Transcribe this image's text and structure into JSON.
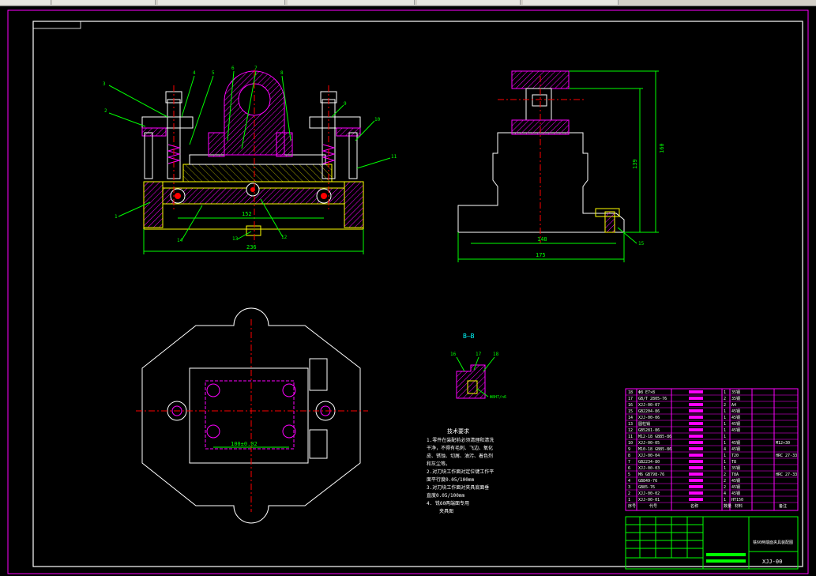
{
  "tech_requirements": {
    "title": "技术要求",
    "lines": [
      "1.零件在装配前必须清理和清洗",
      "干净，不得有毛刺、飞边、氧化",
      "皮、锈蚀、切屑、油污、着色剂",
      "和灰尘等。",
      "2.对刀块工作面对定位键工作平",
      "面平行度0.05/100mm",
      "3.对刀块工作面对夹具底面垂",
      "直度0.05/100mm",
      "4. 铣60两端面专用",
      "夹具图"
    ]
  },
  "section_label": "B—B",
  "dimensions": {
    "front_width": "236",
    "front_inner": "152",
    "side_width": "175",
    "side_inner": "148",
    "side_height1": "160",
    "side_height2": "139",
    "plan_width": "100±0.02",
    "fit_note": "Φ8H7/n6"
  },
  "balloons": [
    "1",
    "2",
    "3",
    "4",
    "5",
    "6",
    "7",
    "8",
    "9",
    "10",
    "11",
    "12",
    "13",
    "14",
    "15",
    "16",
    "17",
    "18"
  ],
  "bom_rows": [
    {
      "no": "18",
      "code": "Φ8 E7×8",
      "qty": "1",
      "mat": "35钢"
    },
    {
      "no": "17",
      "code": "GB/T 2805-76",
      "qty": "2",
      "mat": "35钢"
    },
    {
      "no": "16",
      "code": "XJJ-00-07",
      "qty": "2",
      "mat": "A4"
    },
    {
      "no": "15",
      "code": "GB2204-86",
      "qty": "1",
      "mat": "45钢"
    },
    {
      "no": "14",
      "code": "XJJ-00-06",
      "qty": "1",
      "mat": "45钢"
    },
    {
      "no": "13",
      "code": "圆柱销",
      "qty": "1",
      "mat": "45钢"
    },
    {
      "no": "12",
      "code": "GB5281-86",
      "qty": "1",
      "mat": "45钢"
    },
    {
      "no": "11",
      "code": "M12-18 GB85-86",
      "qty": "1",
      "mat": ""
    },
    {
      "no": "10",
      "code": "XJJ-00-05",
      "qty": "1",
      "mat": "45钢",
      "extra": "M12×30"
    },
    {
      "no": "9",
      "code": "M10-18 GB85-86",
      "qty": "4",
      "mat": "45钢"
    },
    {
      "no": "8",
      "code": "XJJ-00-04",
      "qty": "1",
      "mat": "T20",
      "extra": "HRC 27-33"
    },
    {
      "no": "7",
      "code": "GB2234-80",
      "qty": "1",
      "mat": "T8"
    },
    {
      "no": "6",
      "code": "XJJ-00-03",
      "qty": "1",
      "mat": "35钢"
    },
    {
      "no": "5",
      "code": "M6 GB798-76",
      "qty": "2",
      "mat": "T8A",
      "extra": "HRC 27-33"
    },
    {
      "no": "4",
      "code": "GB849-76",
      "qty": "2",
      "mat": "45钢"
    },
    {
      "no": "3",
      "code": "GB85-76",
      "qty": "2",
      "mat": "45钢"
    },
    {
      "no": "2",
      "code": "XJJ-00-02",
      "qty": "4",
      "mat": "45钢"
    },
    {
      "no": "1",
      "code": "XJJ-00-01",
      "qty": "1",
      "mat": "HT150"
    }
  ],
  "bom_header": [
    "序号",
    "代号",
    "名称",
    "数量",
    "材料",
    "备注"
  ],
  "title_block": {
    "drawing_title": "铣60两端面夹具装配图",
    "drawing_number": "XJJ-00"
  },
  "colors": {
    "frame": "#ff00ff",
    "outline": "#ffffff",
    "part": "#ffff00",
    "dim": "#00ff00",
    "center": "#ff0000",
    "hatch": "#ff00ff"
  }
}
